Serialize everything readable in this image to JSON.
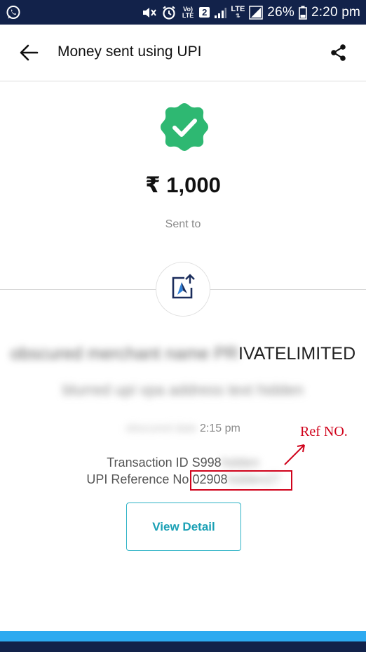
{
  "status_bar": {
    "notification_icon": "whatsapp-icon",
    "volte_label": "Vo) LTE",
    "sim_badge": "2",
    "lte_label": "LTE",
    "battery_percent": "26%",
    "time": "2:20 pm"
  },
  "header": {
    "title": "Money sent using UPI",
    "back_icon": "arrow-left-icon",
    "share_icon": "share-icon"
  },
  "payment": {
    "status_icon": "check-badge-icon",
    "amount": "₹ 1,000",
    "sent_to_label": "Sent to"
  },
  "recipient": {
    "logo_icon": "bank-transfer-icon",
    "name_hidden": "obscured merchant name PR",
    "name_visible": "IVATELIMITED",
    "vpa_hidden": "blurred upi vpa address text hidden"
  },
  "transaction": {
    "date_hidden": "obscured date",
    "time": "2:15 pm",
    "txn_id_label": "Transaction ID",
    "txn_id_visible": "S998",
    "txn_id_hidden": "hidden",
    "upi_ref_label": "UPI Reference No",
    "upi_ref_visible": "02908",
    "upi_ref_hidden": "hidden27"
  },
  "annotation": {
    "label": "Ref NO.",
    "color": "#d0021b"
  },
  "actions": {
    "view_detail": "View Detail"
  },
  "colors": {
    "status_bar": "#12224a",
    "success": "#2eb872",
    "accent": "#1aa0b5",
    "footer_band": "#2eaaf0"
  }
}
